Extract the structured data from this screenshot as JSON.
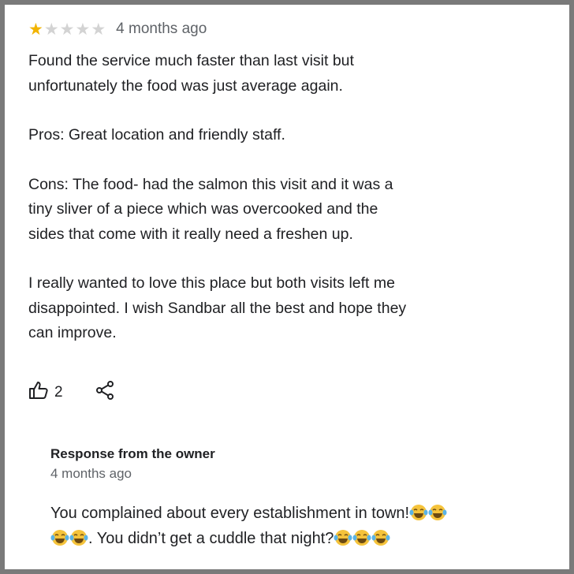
{
  "review": {
    "rating": 1,
    "max_rating": 5,
    "date": "4 months ago",
    "paragraphs": [
      "Found the service much faster than last visit but\nunfortunately the food was just average again.",
      "Pros: Great location and friendly staff.",
      "Cons: The food- had the salmon this visit and it was a\ntiny sliver of a piece which was overcooked and the\nsides that come with it really need a freshen up.",
      "I really wanted to love this place but both visits left me\ndisappointed. I wish Sandbar all the best and hope they\ncan improve."
    ],
    "like_count": "2",
    "like_icon": "thumbs-up-icon",
    "share_icon": "share-icon"
  },
  "response": {
    "title": "Response from the owner",
    "date": "4 months ago",
    "text_part1": "You complained about every establishment in town!",
    "text_part2": ". You didn’t get a cuddle that night?",
    "emoji": "face-with-tears-of-joy-icon"
  },
  "colors": {
    "star_filled": "#f2b400",
    "star_empty": "#d3d3d3",
    "text": "#202124",
    "secondary_text": "#5f6368"
  }
}
